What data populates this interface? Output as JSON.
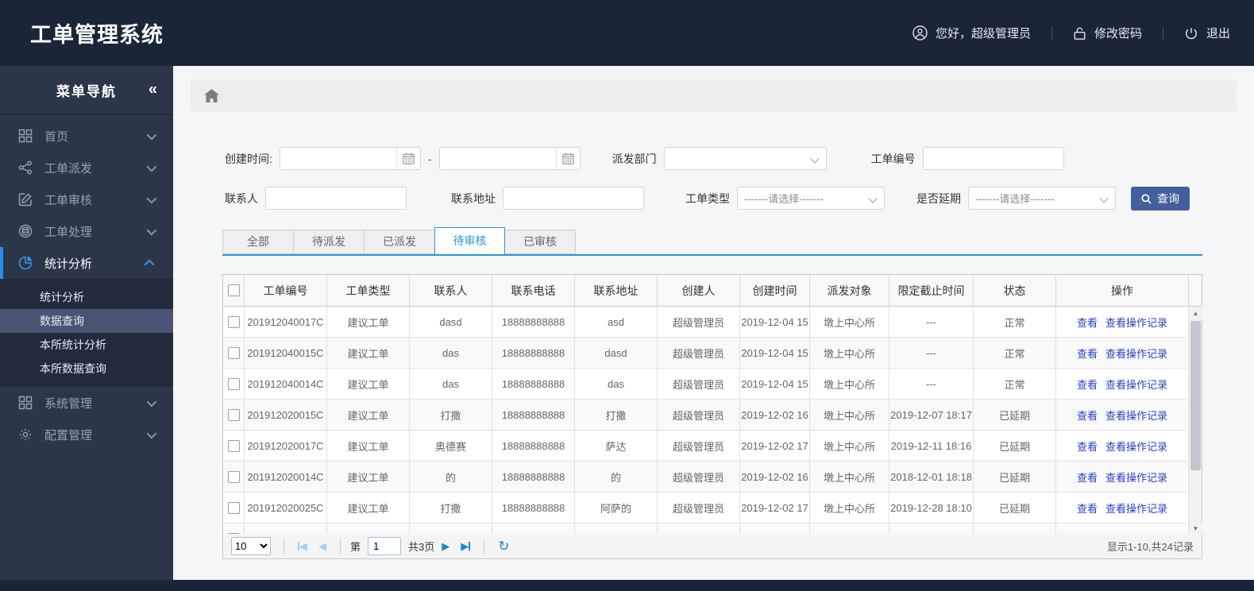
{
  "header": {
    "title": "工单管理系统",
    "greeting": "您好，超级管理员",
    "change_password": "修改密码",
    "logout": "退出"
  },
  "sidebar": {
    "title": "菜单导航",
    "collapse_glyph": "«",
    "items": [
      {
        "id": "home",
        "label": "首页",
        "icon": "grid",
        "active": false
      },
      {
        "id": "dispatch",
        "label": "工单派发",
        "icon": "share",
        "active": false
      },
      {
        "id": "review",
        "label": "工单审核",
        "icon": "edit",
        "active": false
      },
      {
        "id": "process",
        "label": "工单处理",
        "icon": "stack",
        "active": false
      },
      {
        "id": "stats",
        "label": "统计分析",
        "icon": "pie",
        "active": true
      },
      {
        "id": "system",
        "label": "系统管理",
        "icon": "grid2",
        "active": false
      },
      {
        "id": "config",
        "label": "配置管理",
        "icon": "gear",
        "active": false
      }
    ],
    "submenu": [
      "统计分析",
      "数据查询",
      "本所统计分析",
      "本所数据查询"
    ],
    "active_submenu": "数据查询"
  },
  "filters": {
    "create_time_label": "创建时间:",
    "date_separator": "-",
    "dispatch_dept_label": "派发部门",
    "order_no_label": "工单编号",
    "contact_label": "联系人",
    "address_label": "联系地址",
    "order_type_label": "工单类型",
    "delay_label": "是否延期",
    "select_placeholder": "-------请选择-------",
    "search_button": "查询"
  },
  "tabs": [
    {
      "label": "全部",
      "active": false
    },
    {
      "label": "待派发",
      "active": false
    },
    {
      "label": "已派发",
      "active": false
    },
    {
      "label": "待审核",
      "active": true
    },
    {
      "label": "已审核",
      "active": false
    }
  ],
  "table": {
    "columns": [
      "工单编号",
      "工单类型",
      "联系人",
      "联系电话",
      "联系地址",
      "创建人",
      "创建时间",
      "派发对象",
      "限定截止时间",
      "状态",
      "操作"
    ],
    "action_view": "查看",
    "action_log": "查看操作记录",
    "rows": [
      {
        "id": "201912040017C",
        "type": "建议工单",
        "contact": "dasd",
        "phone": "18888888888",
        "address": "asd",
        "creator": "超级管理员",
        "created": "2019-12-04 15",
        "target": "墩上中心所",
        "deadline": "---",
        "status": "正常",
        "status_type": "normal"
      },
      {
        "id": "201912040015C",
        "type": "建议工单",
        "contact": "das",
        "phone": "18888888888",
        "address": "dasd",
        "creator": "超级管理员",
        "created": "2019-12-04 15",
        "target": "墩上中心所",
        "deadline": "---",
        "status": "正常",
        "status_type": "normal"
      },
      {
        "id": "201912040014C",
        "type": "建议工单",
        "contact": "das",
        "phone": "18888888888",
        "address": "das",
        "creator": "超级管理员",
        "created": "2019-12-04 15",
        "target": "墩上中心所",
        "deadline": "---",
        "status": "正常",
        "status_type": "normal"
      },
      {
        "id": "201912020015C",
        "type": "建议工单",
        "contact": "打撒",
        "phone": "18888888888",
        "address": "打撒",
        "creator": "超级管理员",
        "created": "2019-12-02 16",
        "target": "墩上中心所",
        "deadline": "2019-12-07 18:17",
        "status": "已延期",
        "status_type": "delay"
      },
      {
        "id": "201912020017C",
        "type": "建议工单",
        "contact": "奥德赛",
        "phone": "18888888888",
        "address": "萨达",
        "creator": "超级管理员",
        "created": "2019-12-02 17",
        "target": "墩上中心所",
        "deadline": "2019-12-11 18:16",
        "status": "已延期",
        "status_type": "delay"
      },
      {
        "id": "201912020014C",
        "type": "建议工单",
        "contact": "的",
        "phone": "18888888888",
        "address": "的",
        "creator": "超级管理员",
        "created": "2019-12-02 16",
        "target": "墩上中心所",
        "deadline": "2018-12-01 18:18",
        "status": "已延期",
        "status_type": "delay"
      },
      {
        "id": "201912020025C",
        "type": "建议工单",
        "contact": "打撒",
        "phone": "18888888888",
        "address": "阿萨的",
        "creator": "超级管理员",
        "created": "2019-12-02 17",
        "target": "墩上中心所",
        "deadline": "2019-12-28 18:10",
        "status": "已延期",
        "status_type": "delay"
      },
      {
        "id": "",
        "type": "",
        "contact": "",
        "phone": "",
        "address": "",
        "creator": "",
        "created": "",
        "target": "",
        "deadline": "",
        "status": "",
        "status_type": "partial"
      }
    ]
  },
  "pagination": {
    "page_size": "10",
    "page_prefix": "第",
    "page_value": "1",
    "page_suffix": "共3页",
    "summary": "显示1-10,共24记录"
  },
  "colors": {
    "header_bg": "#1b2538",
    "sidebar_bg": "#2b3648",
    "accent_blue": "#2d8cf0",
    "tab_active": "#2a96d2",
    "link_blue": "#2b3fc8",
    "status_normal": "#2b46c8",
    "status_delay": "#e02222",
    "search_button_bg": "#43609c"
  }
}
